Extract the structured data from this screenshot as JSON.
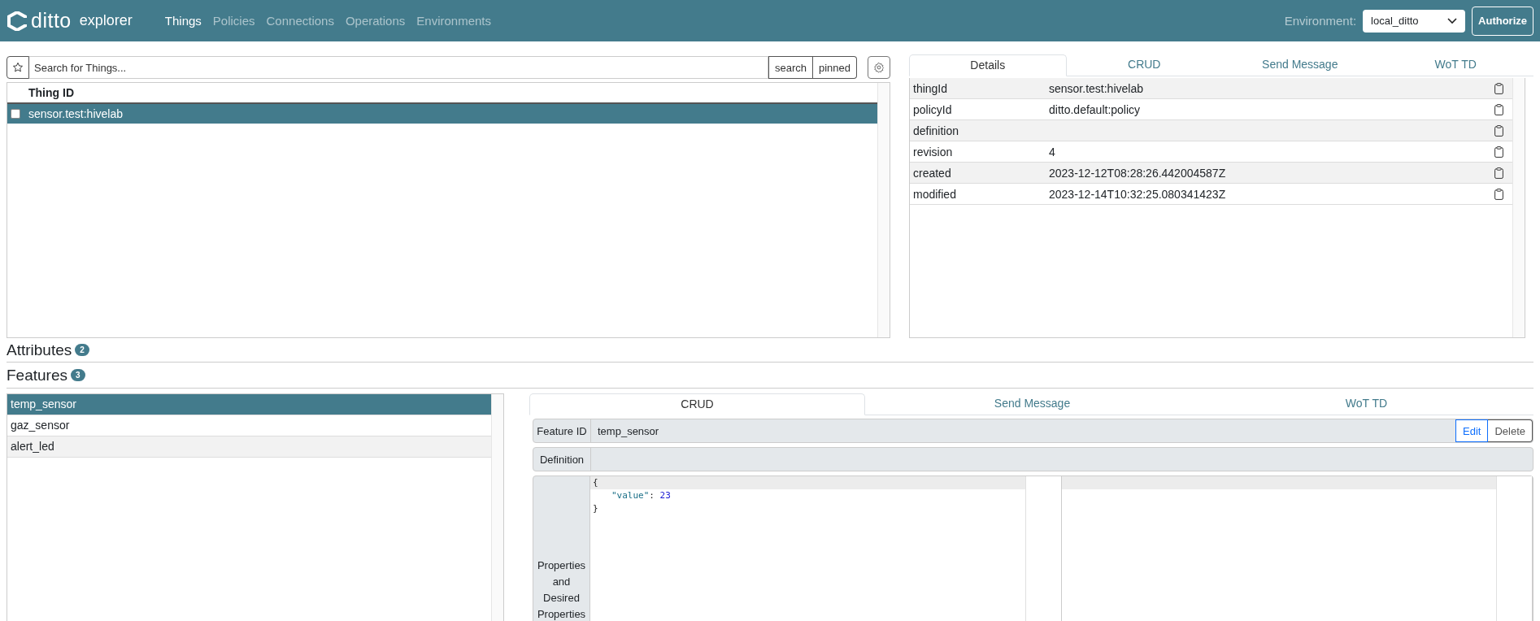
{
  "navbar": {
    "brand": {
      "name": "ditto",
      "subtitle": "explorer"
    },
    "links": [
      {
        "label": "Things",
        "selected": true
      },
      {
        "label": "Policies",
        "selected": false
      },
      {
        "label": "Connections",
        "selected": false
      },
      {
        "label": "Operations",
        "selected": false
      },
      {
        "label": "Environments",
        "selected": false
      }
    ],
    "environment": {
      "label": "Environment:",
      "value": "local_ditto"
    },
    "authorize_button": "Authorize"
  },
  "things": {
    "search": {
      "placeholder": "Search for Things..."
    },
    "search_button": "search",
    "pinned_button": "pinned",
    "table": {
      "columns": [
        "Thing ID"
      ],
      "rows": [
        {
          "thing_id": "sensor.test:hivelab",
          "selected": true,
          "checked": false
        }
      ]
    }
  },
  "details": {
    "tabs": [
      {
        "label": "Details",
        "selected": true
      },
      {
        "label": "CRUD",
        "selected": false
      },
      {
        "label": "Send Message",
        "selected": false
      },
      {
        "label": "WoT TD",
        "selected": false
      }
    ],
    "rows": [
      {
        "key": "thingId",
        "value": "sensor.test:hivelab"
      },
      {
        "key": "policyId",
        "value": "ditto.default:policy"
      },
      {
        "key": "definition"
      },
      {
        "key": "revision",
        "value": "4"
      },
      {
        "key": "created",
        "value": "2023-12-12T08:28:26.442004587Z"
      },
      {
        "key": "modified",
        "value": "2023-12-14T10:32:25.080341423Z"
      }
    ]
  },
  "sections": [
    {
      "title": "Attributes",
      "count": "2"
    },
    {
      "title": "Features",
      "count": "3"
    }
  ],
  "features": {
    "items": [
      {
        "label": "temp_sensor",
        "selected": true
      },
      {
        "label": "gaz_sensor",
        "selected": false
      },
      {
        "label": "alert_led",
        "selected": false
      }
    ],
    "tabs": [
      {
        "label": "CRUD",
        "selected": true
      },
      {
        "label": "Send Message",
        "selected": false
      },
      {
        "label": "WoT TD",
        "selected": false
      }
    ],
    "feature_id": {
      "label": "Feature ID",
      "value": "temp_sensor"
    },
    "edit_button": "Edit",
    "delete_button": "Delete",
    "definition": {
      "label": "Definition"
    },
    "properties": {
      "label": "Properties and Desired Properties",
      "code_lines": [
        [
          {
            "kind": "punct",
            "text": "{"
          }
        ],
        [
          {
            "kind": "key",
            "text": "\"value\""
          },
          {
            "kind": "punct",
            "text": ": "
          },
          {
            "kind": "number",
            "text": "23"
          }
        ],
        [
          {
            "kind": "punct",
            "text": "}"
          }
        ]
      ]
    }
  }
}
